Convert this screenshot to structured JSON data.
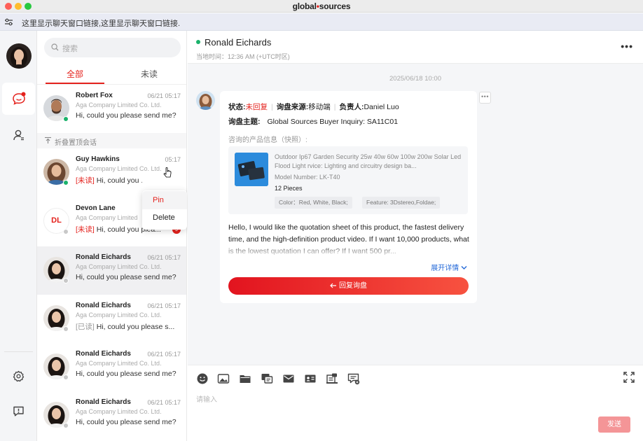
{
  "window": {
    "brand_left": "global",
    "brand_dot": "•",
    "brand_right": "sources"
  },
  "link_bar": {
    "text": "这里显示聊天窗口链接,这里显示聊天窗口链接."
  },
  "rail": {
    "icons": [
      "profile-avatar",
      "chat-bubble-icon",
      "contacts-icon",
      "settings-icon",
      "feedback-icon"
    ],
    "active": "chat-bubble-icon"
  },
  "list": {
    "search_placeholder": "搜索",
    "tabs": [
      "全部",
      "未读"
    ],
    "folded_label": "折叠置顶会话",
    "conversations": [
      {
        "name": "Robert Fox",
        "time": "06/21 05:17",
        "company": "Aga Company Limited Co. Ltd.",
        "tag": "",
        "message": "Hi, could you please send me?",
        "status": "online",
        "badge": ""
      },
      {
        "name": "Guy Hawkins",
        "time": "05:17",
        "company": "Aga Company Limited Co. Ltd.",
        "tag": "[未读]",
        "message": " Hi, could you ...",
        "status": "online",
        "badge": ""
      },
      {
        "name": "Devon Lane",
        "time": "",
        "company": "Aga Company Limited Co. Ltd.",
        "tag": "[未读]",
        "message": " Hi, could you plea...",
        "status": "offline",
        "badge": "9",
        "initials": "DL"
      },
      {
        "name": "Ronald Eichards",
        "time": "06/21 05:17",
        "company": "Aga Company Limited Co. Ltd.",
        "tag": "",
        "message": "Hi, could you please send me?",
        "status": "offline",
        "badge": ""
      },
      {
        "name": "Ronald Eichards",
        "time": "06/21 05:17",
        "company": "Aga Company Limited Co. Ltd.",
        "tag": "[已读]",
        "message": " Hi, could you please s...",
        "status": "offline",
        "badge": ""
      },
      {
        "name": "Ronald Eichards",
        "time": "06/21 05:17",
        "company": "Aga Company Limited Co. Ltd.",
        "tag": "",
        "message": "Hi, could you please send me?",
        "status": "offline",
        "badge": ""
      },
      {
        "name": "Ronald Eichards",
        "time": "06/21 05:17",
        "company": "Aga Company Limited Co. Ltd.",
        "tag": "",
        "message": "Hi, could you please send me?",
        "status": "offline",
        "badge": ""
      }
    ]
  },
  "context_menu": {
    "items": [
      "Pin",
      "Delete"
    ]
  },
  "chat": {
    "contact_name": "Ronald Eichards",
    "local_time": "当地时间：12:36 AM (+UTC时区)",
    "date_separator": "2025/06/18 10:00",
    "inquiry": {
      "status_key": "状态:",
      "status_value": "未回复",
      "source_key": "询盘来源:",
      "source_value": "移动端",
      "owner_key": "负责人:",
      "owner_value": "Daniel Luo",
      "subject_key": "询盘主题:",
      "subject_value": "Global Sources Buyer Inquiry: SA11C01",
      "product_label": "咨询的产品信息（快照）:",
      "product_title": "Outdoor Ip67 Garden Security 25w 40w 60w 100w 200w Solar Led Flood Light rvice: Lighting and circuitry design ba...",
      "model": "Model Number: LK-T40",
      "quantity": "12 Pieces",
      "chips": [
        "Color：Red, White, Black;",
        "Feature: 3Dstereo,Foldae;"
      ],
      "body": "Hello, I would like the quotation sheet of this product, the fastest delivery time, and the high-definition product video. If I want 10,000 products, what is the lowest quotation I can offer? If I want 500 pr...",
      "expand_label": "展开详情",
      "reply_label": "回复询盘"
    },
    "composer": {
      "placeholder": "请输入",
      "send_label": "发送",
      "tools": [
        "emoji-icon",
        "image-icon",
        "folder-icon",
        "quick-reply-icon",
        "mail-icon",
        "business-card-icon",
        "product-icon",
        "inquiry-icon"
      ]
    }
  },
  "colors": {
    "accent": "#e4211c",
    "link": "#2469d8",
    "online": "#1ab26b",
    "send_disabled": "#f49597"
  }
}
